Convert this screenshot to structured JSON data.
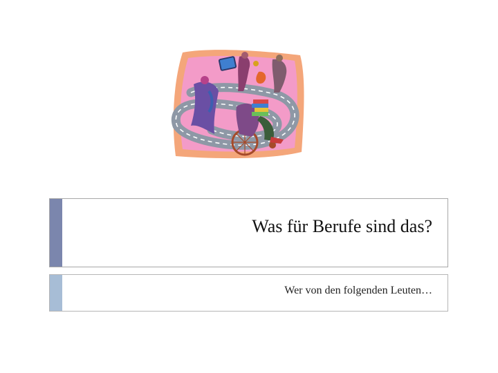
{
  "slide": {
    "title": "Was für Berufe sind das?",
    "subtitle": "Wer von den folgenden Leuten…"
  },
  "clipart": {
    "icon": "people-on-road-illustration-icon"
  },
  "colors": {
    "title_accent": "#7b86ad",
    "subtitle_accent": "#a7bdd6",
    "frame_pink": "#f39bc8",
    "road_gray": "#8e98a6"
  }
}
